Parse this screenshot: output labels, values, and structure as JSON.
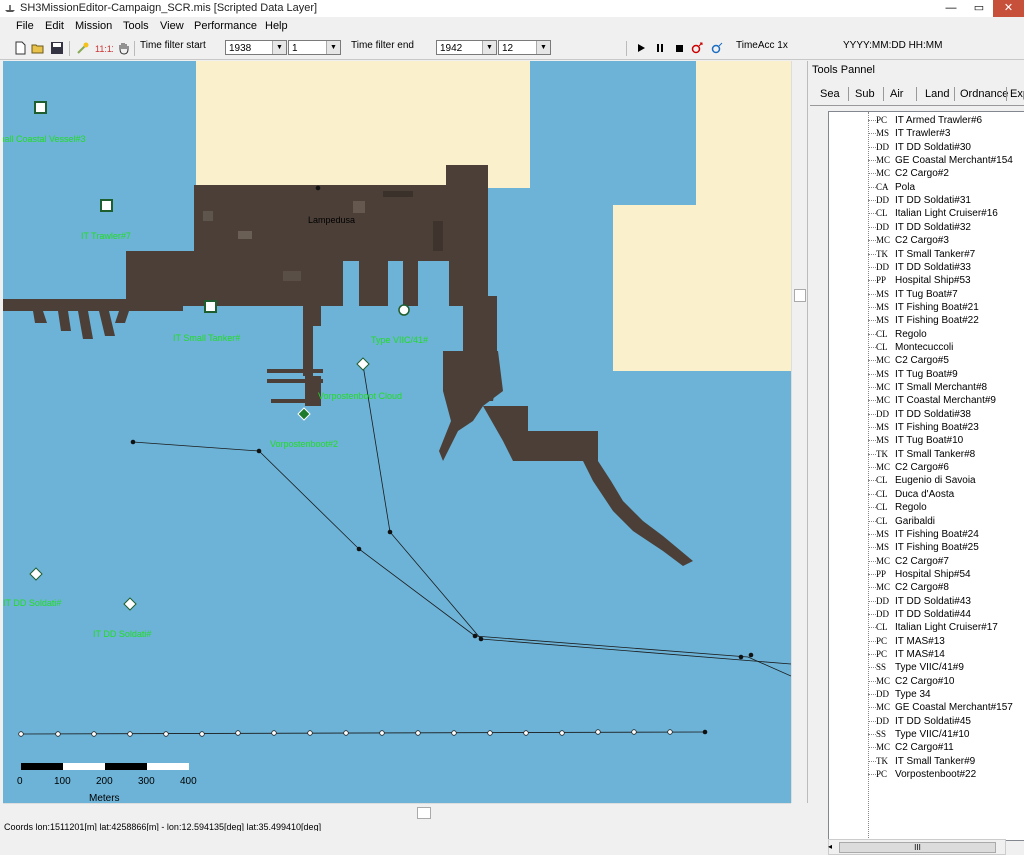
{
  "window": {
    "title": "SH3MissionEditor-Campaign_SCR.mis [Scripted Data Layer]"
  },
  "menu": [
    "File",
    "Edit",
    "Mission",
    "Tools",
    "View",
    "Performance",
    "Help"
  ],
  "toolbar": {
    "time_filter_start_label": "Time filter start",
    "start_year": "1938",
    "start_month": "1",
    "time_filter_end_label": "Time filter end",
    "end_year": "1942",
    "end_month": "12",
    "time_acc": "TimeAcc 1x",
    "datetime_format": "YYYY:MM:DD HH:MM",
    "icon_names": [
      "new-file-icon",
      "open-folder-icon",
      "save-icon",
      "magic-wand-icon",
      "clock-icon",
      "hand-pan-icon",
      "play-icon",
      "pause-icon",
      "stop-icon",
      "add-unit-icon",
      "unit-icon"
    ]
  },
  "map": {
    "labels": {
      "lampedusa": "Lampedusa",
      "coastal_vessel": "Small Coastal Vessel#3",
      "trawler": "IT Trawler#7",
      "small_tanker": "IT Small Tanker#",
      "type_vii": "Type VIIC/41#",
      "vorposten_cloud": "Vorpostenboot Cloud",
      "vorposten": "Vorpostenboot#2",
      "dd_soldati_left": "IT DD Soldati#",
      "dd_soldati_right": "IT DD Soldati#"
    },
    "scale": {
      "ticks": [
        "0",
        "100",
        "200",
        "300",
        "400"
      ],
      "unit": "Meters"
    },
    "colors": {
      "sea": "#6cb3d7",
      "land": "#faf0cc",
      "label": "#22dd22"
    }
  },
  "status": {
    "coords": "Coords lon:1511201[m] lat:4258866[m] - lon:12.594135[deg] lat:35.499410[deg]"
  },
  "panel": {
    "title": "Tools Pannel",
    "tabs": [
      "Sea",
      "Sub",
      "Air",
      "Land",
      "Ordnance",
      "Exp"
    ],
    "items": [
      {
        "code": "PC",
        "name": "IT Armed Trawler#6"
      },
      {
        "code": "MS",
        "name": "IT Trawler#3"
      },
      {
        "code": "DD",
        "name": "IT DD Soldati#30"
      },
      {
        "code": "MC",
        "name": "GE Coastal Merchant#154"
      },
      {
        "code": "MC",
        "name": "C2 Cargo#2"
      },
      {
        "code": "CA",
        "name": "Pola"
      },
      {
        "code": "DD",
        "name": "IT DD Soldati#31"
      },
      {
        "code": "CL",
        "name": "Italian Light Cruiser#16"
      },
      {
        "code": "DD",
        "name": "IT DD Soldati#32"
      },
      {
        "code": "MC",
        "name": "C2 Cargo#3"
      },
      {
        "code": "TK",
        "name": "IT Small Tanker#7"
      },
      {
        "code": "DD",
        "name": "IT DD Soldati#33"
      },
      {
        "code": "PP",
        "name": "Hospital Ship#53"
      },
      {
        "code": "MS",
        "name": "IT Tug Boat#7"
      },
      {
        "code": "MS",
        "name": "IT Fishing Boat#21"
      },
      {
        "code": "MS",
        "name": "IT Fishing Boat#22"
      },
      {
        "code": "CL",
        "name": "Regolo"
      },
      {
        "code": "CL",
        "name": "Montecuccoli"
      },
      {
        "code": "MC",
        "name": "C2 Cargo#5"
      },
      {
        "code": "MS",
        "name": "IT Tug Boat#9"
      },
      {
        "code": "MC",
        "name": "IT Small Merchant#8"
      },
      {
        "code": "MC",
        "name": "IT Coastal Merchant#9"
      },
      {
        "code": "DD",
        "name": "IT DD Soldati#38"
      },
      {
        "code": "MS",
        "name": "IT Fishing Boat#23"
      },
      {
        "code": "MS",
        "name": "IT Tug Boat#10"
      },
      {
        "code": "TK",
        "name": "IT Small Tanker#8"
      },
      {
        "code": "MC",
        "name": "C2 Cargo#6"
      },
      {
        "code": "CL",
        "name": "Eugenio di Savoia"
      },
      {
        "code": "CL",
        "name": "Duca d'Aosta"
      },
      {
        "code": "CL",
        "name": "Regolo"
      },
      {
        "code": "CL",
        "name": "Garibaldi"
      },
      {
        "code": "MS",
        "name": "IT Fishing Boat#24"
      },
      {
        "code": "MS",
        "name": "IT Fishing Boat#25"
      },
      {
        "code": "MC",
        "name": "C2 Cargo#7"
      },
      {
        "code": "PP",
        "name": "Hospital Ship#54"
      },
      {
        "code": "MC",
        "name": "C2 Cargo#8"
      },
      {
        "code": "DD",
        "name": "IT DD Soldati#43"
      },
      {
        "code": "DD",
        "name": "IT DD Soldati#44"
      },
      {
        "code": "CL",
        "name": "Italian Light Cruiser#17"
      },
      {
        "code": "PC",
        "name": "IT MAS#13"
      },
      {
        "code": "PC",
        "name": "IT MAS#14"
      },
      {
        "code": "SS",
        "name": "Type VIIC/41#9"
      },
      {
        "code": "MC",
        "name": "C2 Cargo#10"
      },
      {
        "code": "DD",
        "name": "Type 34"
      },
      {
        "code": "MC",
        "name": "GE Coastal Merchant#157"
      },
      {
        "code": "DD",
        "name": "IT DD Soldati#45"
      },
      {
        "code": "SS",
        "name": "Type VIIC/41#10"
      },
      {
        "code": "MC",
        "name": "C2 Cargo#11"
      },
      {
        "code": "TK",
        "name": "IT Small Tanker#9"
      },
      {
        "code": "PC",
        "name": "Vorpostenboot#22"
      }
    ],
    "hscroll_grip": "III"
  }
}
